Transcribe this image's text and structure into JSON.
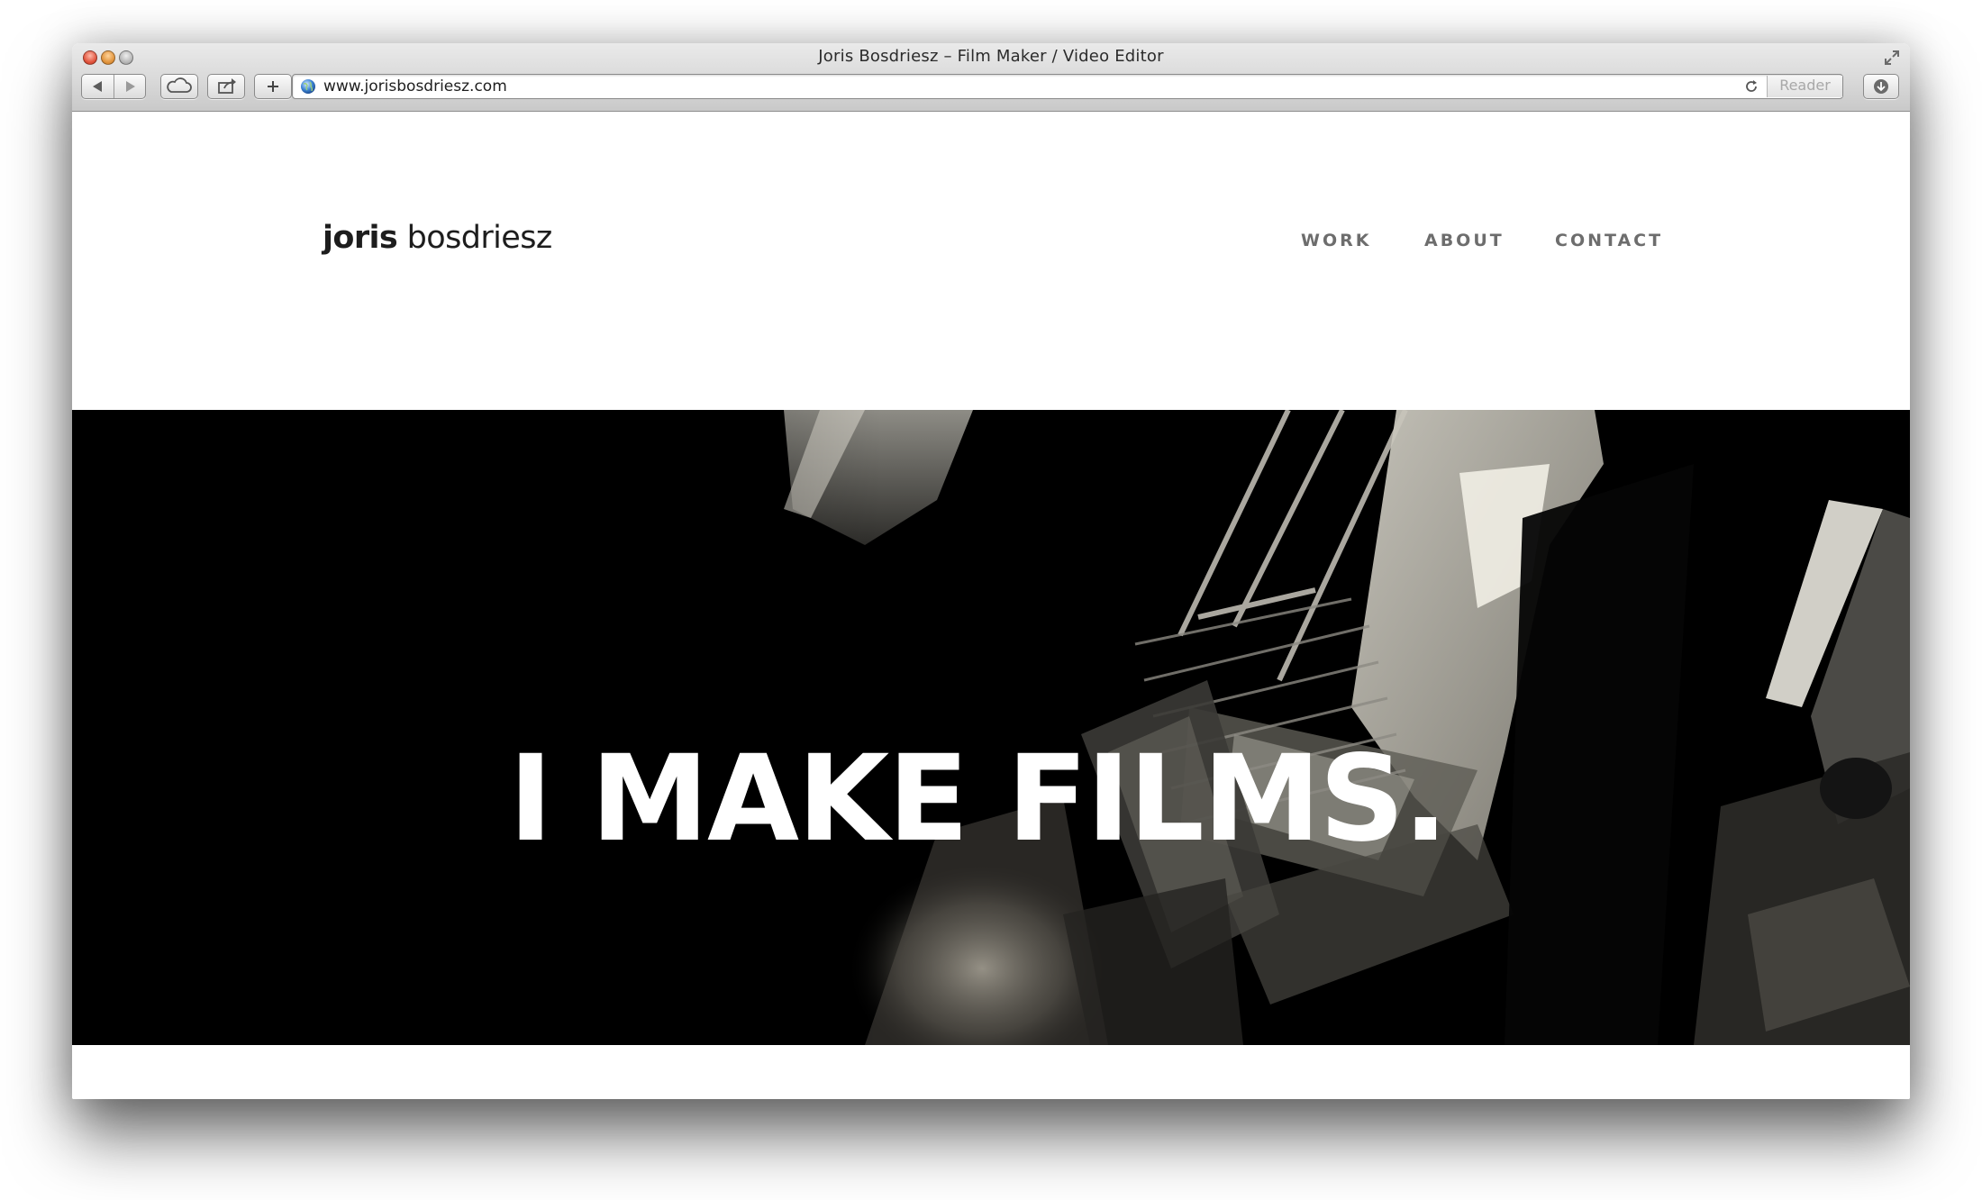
{
  "browser": {
    "window_title": "Joris Bosdriesz – Film Maker / Video Editor",
    "url": "www.jorisbosdriesz.com",
    "reader_label": "Reader",
    "icons": {
      "close": "close-window-icon",
      "minimize": "minimize-window-icon",
      "zoom": "zoom-window-icon",
      "fullscreen": "fullscreen-icon",
      "back": "back-arrow-icon",
      "forward": "forward-arrow-icon",
      "icloud": "cloud-icon",
      "share": "share-icon",
      "new_tab": "plus-icon",
      "site": "globe-icon",
      "reload": "reload-icon",
      "downloads": "download-icon"
    }
  },
  "site": {
    "logo": {
      "first": "joris",
      "last": "bosdriesz"
    },
    "nav": [
      {
        "label": "WORK"
      },
      {
        "label": "ABOUT"
      },
      {
        "label": "CONTACT"
      }
    ],
    "hero": {
      "headline": "I MAKE FILMS.",
      "image": "black-and-white-film-set-photo"
    }
  },
  "colors": {
    "nav_text": "#6d6d6d",
    "logo_text": "#1d1d1d",
    "hero_background": "#000000",
    "headline_text": "#ffffff",
    "page_background": "#ffffff"
  }
}
